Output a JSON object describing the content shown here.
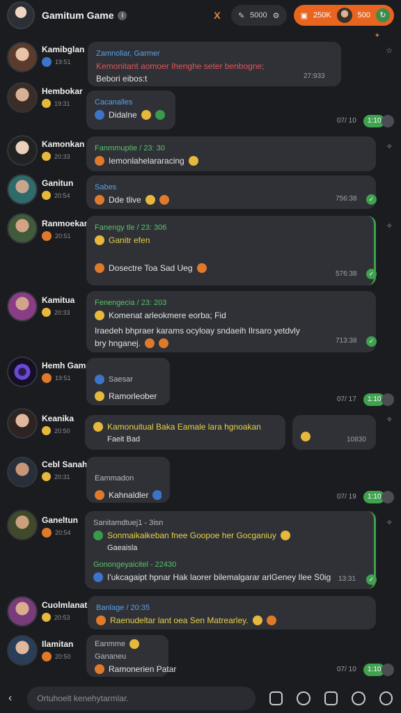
{
  "header": {
    "title": "Gamitum Game",
    "close_label": "X",
    "pill_left_value": "5000",
    "pill_right_label": "250K",
    "pill_right_value": "500"
  },
  "messages": [
    {
      "name": "Kamibglan",
      "time_meta": "19:51",
      "quote_header": "Zamnoliar, Garmer",
      "line1": "Kemonitant aomoer Ihenghe seter benbogne;",
      "line2": "Bebori eibos:t",
      "time": "27:933"
    },
    {
      "name": "Hembokar",
      "time_meta": "19:31",
      "quote_header": "Cacanalles",
      "line1": "Didalne",
      "time": "07/ 10",
      "reaction": "1:10"
    },
    {
      "name": "Kamonkan",
      "time_meta": "20:33",
      "quote_header": "Fanmmuptie / 23: 30",
      "line1": "Iemonlahelararacing"
    },
    {
      "name": "Ganitun",
      "time_meta": "20:54",
      "quote_header": "Sabes",
      "line1": "Dde tlive",
      "time": "756:38"
    },
    {
      "name": "Ranmoekar",
      "time_meta": "20:51",
      "quote_header": "Fanengy tle / 23: 306",
      "line1": "Ganitr efen",
      "line2": "Dosectre Toa  Sad Ueg",
      "time": "576:38"
    },
    {
      "name": "Kamitua",
      "time_meta": "20:33",
      "quote_header": "Fenengecia / 23: 203",
      "line1": "Komenat arleokmere eorba; Fid",
      "line2": "Iraedeh bhpraer karams ocyloay sndaeih Ilrsaro yetdvly",
      "line3": "bry hnganej.",
      "time": "713:38"
    },
    {
      "name": "Hemh Gamer",
      "time_meta": "19:51",
      "quote_header": "Saesar",
      "line1": "Ramorleober",
      "time": "07/ 17",
      "reaction": "1:10"
    },
    {
      "name": "Keanika",
      "time_meta": "20:50",
      "line1": "Kamonuitual Baka Eamale lara hgnoakan",
      "line2": "Faeit Bad",
      "time": "10830"
    },
    {
      "name": "Cebl Sanaharan",
      "time_meta": "20:31",
      "quote_header": "Eammadon",
      "line1": "Kahnaldler",
      "time": "07/ 19",
      "reaction": "1:10"
    },
    {
      "name": "Ganeltun",
      "time_meta": "20:54",
      "quote_header": "Sanitamdtuej1 - 3isn",
      "line1": "Sonmaikaikeban fnee Goopoe her Gocganiuy",
      "line2": "Gaeaisla",
      "quote2_header": "Gonongeyaicitel - 22430",
      "line3": "I'ukcagaipt hpnar Hak laorer bilemalgarar arlGeney Ilee S0ig",
      "time": "13:31"
    },
    {
      "name": "Cuolmlanat",
      "time_meta": "20:53",
      "quote_header": "Banlage / 20:35",
      "line1": "Raenudeltar lant oea  Sen Matrearley."
    },
    {
      "name": "Ilamitan",
      "time_meta": "20:50",
      "quote_header": "Eanmme",
      "quote2_header": "Gananeu",
      "line1": "Ramonerien  Patar",
      "time": "07/ 10",
      "reaction": "1:10"
    }
  ],
  "composer": {
    "placeholder": "Ortuhoelt kenehytarmlar."
  },
  "colors": {
    "background": "#1b1c1f",
    "bubble": "#2f3136",
    "accent_green": "#3fa24f",
    "accent_orange": "#e8641f"
  }
}
